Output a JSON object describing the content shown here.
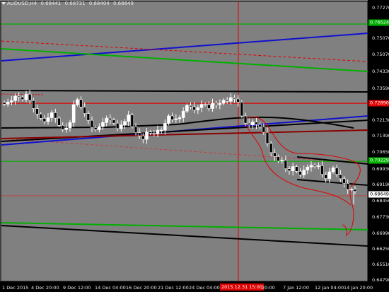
{
  "chart": {
    "symbol": "AUDUSD,H4",
    "ohlc": [
      "0.68441",
      "0.68731",
      "0.68404",
      "0.68649"
    ],
    "price_axis": [
      "0.77270",
      "0.76524",
      "0.75070",
      "0.74330",
      "0.73590",
      "0.72890",
      "0.72130",
      "0.71390",
      "0.70650",
      "0.70229",
      "0.69930",
      "0.69190",
      "0.68649",
      "0.68450",
      "0.67730",
      "0.66990",
      "0.66250",
      "0.65510",
      "0.64790"
    ],
    "price_tags": [
      {
        "label": "0.76524",
        "color": "#00b000"
      },
      {
        "label": "0.72890",
        "color": "#e00000"
      },
      {
        "label": "0.70229",
        "color": "#00b000"
      },
      {
        "label": "0.68649",
        "color": "#ffffff"
      }
    ],
    "time_axis": [
      "1 Dec 2015",
      "4 Dec 20:00",
      "9 Dec 12:00",
      "14 Dec 04:00",
      "16 Dec 20:00",
      "21 Dec 12:00",
      "24 Dec 04:00",
      "2015.12.31 15:00",
      "20:00",
      "7 Jan 12:00",
      "12 Jan 04:00",
      "14 Jan 20:00"
    ],
    "selected_time": "2015.12.31 15:00",
    "colors": {
      "background": "#000000",
      "grid": "#3a3a3a",
      "bull_candle": "#ffffff",
      "bear_candle": "#000000",
      "candle_outline": "#ffffff",
      "support": "#00b000",
      "resistance": "#e00000",
      "trendline": "#1010d0",
      "ma": "#000000",
      "dark_red": "#8b0000"
    }
  },
  "chart_data": {
    "type": "candlestick",
    "symbol": "AUDUSD",
    "timeframe": "H4",
    "ylim": [
      0.6479,
      0.7727
    ],
    "y_ticks": [
      0.7727,
      0.7507,
      0.7433,
      0.7359,
      0.7213,
      0.7139,
      0.7065,
      0.6993,
      0.6919,
      0.6845,
      0.6773,
      0.6699,
      0.6625,
      0.6551,
      0.6479
    ],
    "last_price": 0.68649,
    "horizontal_levels": [
      {
        "price": 0.76524,
        "color": "#00b000"
      },
      {
        "price": 0.7289,
        "color": "#e00000"
      },
      {
        "price": 0.70229,
        "color": "#00b000"
      },
      {
        "price": 0.68649,
        "color": "#e00000"
      }
    ],
    "close_series": [
      0.7285,
      0.7295,
      0.7301,
      0.7322,
      0.7318,
      0.7306,
      0.7331,
      0.7302,
      0.7265,
      0.724,
      0.722,
      0.7205,
      0.7223,
      0.7246,
      0.7221,
      0.7188,
      0.7169,
      0.7176,
      0.7201,
      0.7283,
      0.7306,
      0.7272,
      0.7242,
      0.7211,
      0.7178,
      0.7168,
      0.7182,
      0.7201,
      0.7221,
      0.7213,
      0.7198,
      0.7173,
      0.719,
      0.7206,
      0.7236,
      0.7182,
      0.7154,
      0.714,
      0.7124,
      0.7158,
      0.7152,
      0.7149,
      0.7166,
      0.7166,
      0.7197,
      0.7231,
      0.7214,
      0.7218,
      0.7223,
      0.7253,
      0.7279,
      0.7273,
      0.7258,
      0.7269,
      0.7284,
      0.7283,
      0.7265,
      0.7289,
      0.7283,
      0.7289,
      0.7303,
      0.7298,
      0.7315,
      0.7309,
      0.7295,
      0.7231,
      0.7198,
      0.719,
      0.7203,
      0.7192,
      0.7181,
      0.7156,
      0.7105,
      0.7063,
      0.7045,
      0.7024,
      0.7028,
      0.6989,
      0.6979,
      0.6999,
      0.6977,
      0.6961,
      0.6983,
      0.6997,
      0.7005,
      0.6999,
      0.7003,
      0.6963,
      0.6944,
      0.6975,
      0.6993,
      0.6963,
      0.6943,
      0.6922,
      0.6894,
      0.6895,
      0.6885
    ]
  }
}
